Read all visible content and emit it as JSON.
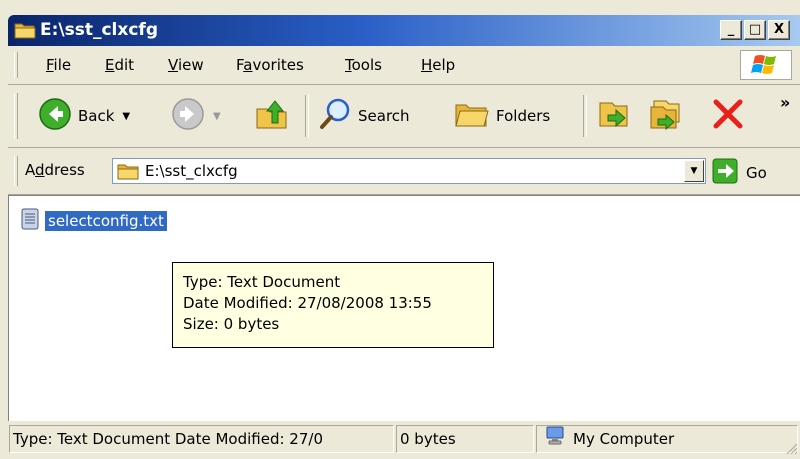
{
  "window": {
    "title": "E:\\sst_clxcfg",
    "caption_buttons": {
      "minimize": "_",
      "maximize": "□",
      "close": "X"
    }
  },
  "menu": [
    {
      "label_pre": "",
      "mnemonic": "F",
      "label_post": "ile"
    },
    {
      "label_pre": "",
      "mnemonic": "E",
      "label_post": "dit"
    },
    {
      "label_pre": "",
      "mnemonic": "V",
      "label_post": "iew"
    },
    {
      "label_pre": "F",
      "mnemonic": "a",
      "label_post": "vorites"
    },
    {
      "label_pre": "",
      "mnemonic": "T",
      "label_post": "ools"
    },
    {
      "label_pre": "",
      "mnemonic": "H",
      "label_post": "elp"
    }
  ],
  "toolbar": {
    "back_label": "Back",
    "search_label": "Search",
    "folders_label": "Folders",
    "overflow": "»"
  },
  "address": {
    "label_pre": "A",
    "mnemonic": "d",
    "label_post": "dress",
    "value": "E:\\sst_clxcfg",
    "go_label": "Go"
  },
  "files": [
    {
      "name": "selectconfig.txt",
      "icon": "text-file-icon",
      "selected": true
    }
  ],
  "tooltip": {
    "line1": "Type: Text Document",
    "line2": "Date Modified: 27/08/2008 13:55",
    "line3": "Size: 0 bytes"
  },
  "status": {
    "info": "Type: Text Document Date Modified: 27/0",
    "size": "0 bytes",
    "zone": "My Computer"
  },
  "colors": {
    "title_gradient_start": "#0a246a",
    "selection": "#316ac5",
    "tooltip_bg": "#ffffe1",
    "chrome": "#ece9d8"
  }
}
